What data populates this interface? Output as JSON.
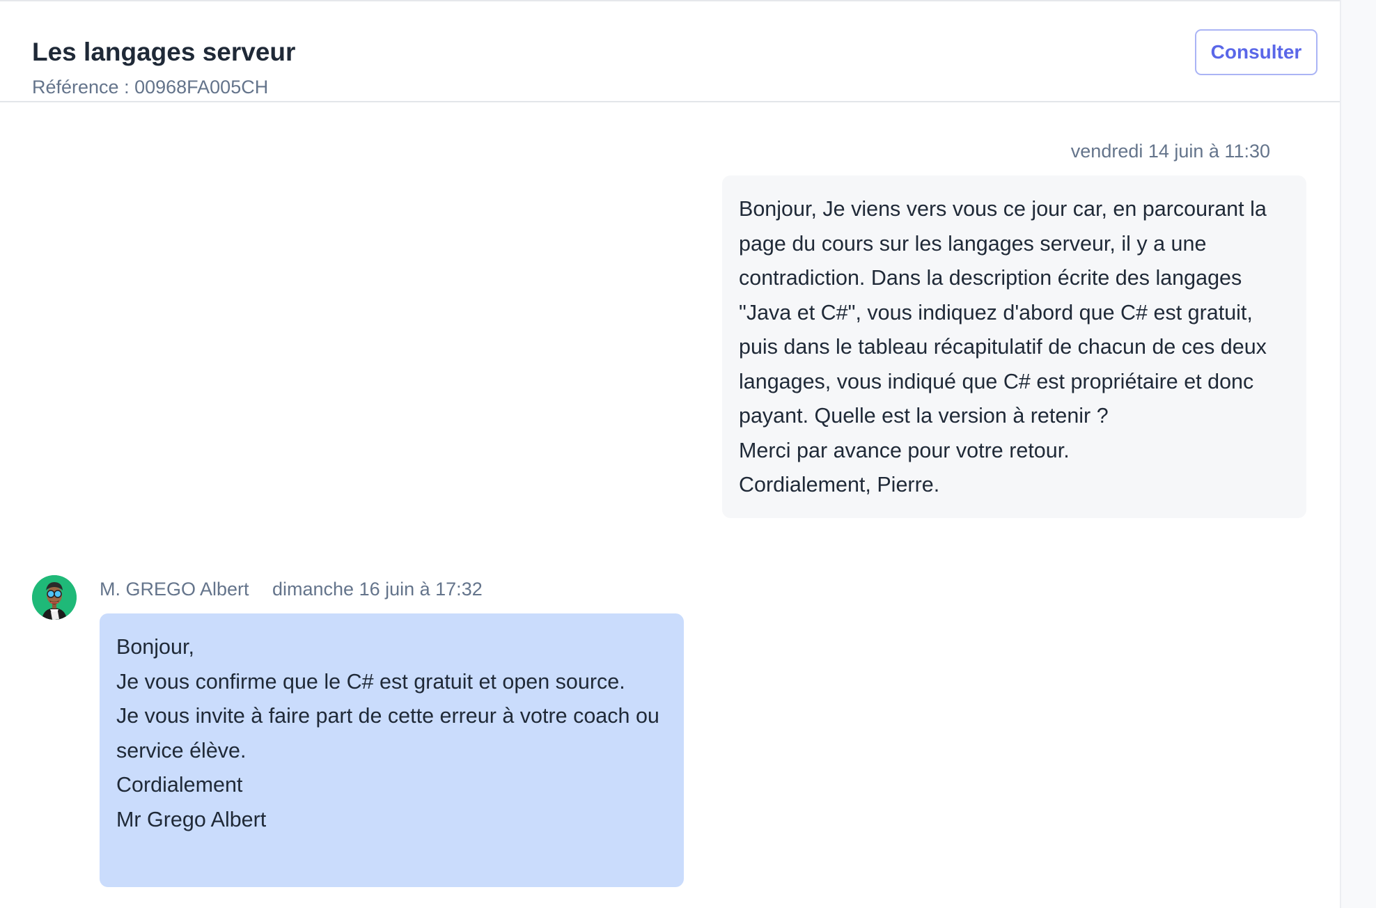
{
  "header": {
    "title": "Les langages serveur",
    "reference": "Référence : 00968FA005CH",
    "consult_label": "Consulter"
  },
  "messages": [
    {
      "timestamp": "vendredi 14 juin à 11:30",
      "lines": [
        "Bonjour, Je viens vers vous ce jour car, en parcourant la page du cours sur les langages serveur, il y a une contradiction. Dans la description écrite des langages \"Java et C#\", vous indiquez d'abord que C# est gratuit, puis dans le tableau récapitulatif de chacun de ces deux langages, vous indiqué que C# est propriétaire et donc payant. Quelle est la version à retenir ?",
        "Merci par avance pour votre retour.",
        "Cordialement, Pierre."
      ]
    },
    {
      "sender": "M. GREGO Albert",
      "timestamp": "dimanche 16 juin à 17:32",
      "avatar_icon": "user-avatar-icon",
      "lines": [
        "Bonjour,",
        "Je vous confirme que le C# est gratuit et open source.",
        "Je vous invite à faire part de cette erreur à votre coach ou service élève.",
        "Cordialement",
        "Mr Grego Albert"
      ]
    }
  ],
  "colors": {
    "accent": "#5a67e8",
    "received_bubble": "#cadcfc",
    "sent_bubble": "#f6f7f9",
    "avatar_bg": "#1fb978",
    "muted_text": "#64748b"
  }
}
